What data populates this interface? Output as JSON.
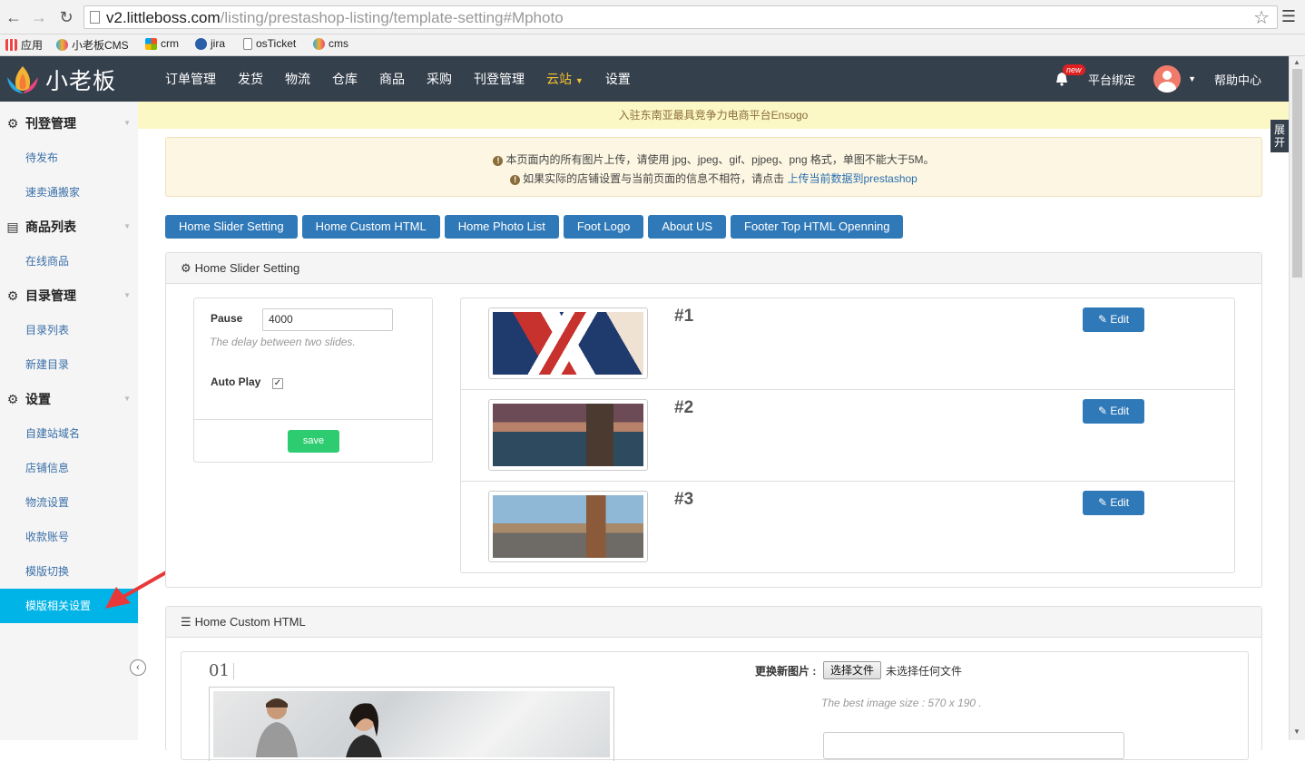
{
  "browser": {
    "url_host": "v2.littleboss.com",
    "url_path": "/listing/prestashop-listing/template-setting#Mphoto",
    "bookmarks": [
      "应用",
      "小老板CMS",
      "crm",
      "jira",
      "osTicket",
      "cms"
    ]
  },
  "topbar": {
    "logo_text": "小老板",
    "nav": [
      "订单管理",
      "发货",
      "物流",
      "仓库",
      "商品",
      "采购",
      "刊登管理",
      "云站",
      "设置"
    ],
    "active_nav": "云站",
    "new_badge": "new",
    "platform_bind": "平台绑定",
    "help_center": "帮助中心",
    "active_color": "#f5c230"
  },
  "sidebar": {
    "groups": [
      {
        "label": "刊登管理",
        "items": [
          "待发布",
          "速卖通搬家"
        ]
      },
      {
        "label": "商品列表",
        "items": [
          "在线商品"
        ]
      },
      {
        "label": "目录管理",
        "items": [
          "目录列表",
          "新建目录"
        ]
      },
      {
        "label": "设置",
        "items": [
          "自建站域名",
          "店铺信息",
          "物流设置",
          "收款账号",
          "模版切换",
          "模版相关设置"
        ]
      }
    ],
    "active_item": "模版相关设置",
    "active_color": "#00b4e8"
  },
  "expand_tab": "展开",
  "announcement": "入驻东南亚最具竞争力电商平台Ensogo",
  "notice": {
    "line1": "本页面内的所有图片上传，请使用 jpg、jpeg、gif、pjpeg、png 格式，单图不能大于5M。",
    "line2_prefix": "如果实际的店铺设置与当前页面的信息不相符，请点击",
    "line2_link": "上传当前数据到prestashop"
  },
  "tabs": [
    "Home Slider Setting",
    "Home Custom HTML",
    "Home Photo List",
    "Foot Logo",
    "About US",
    "Footer Top HTML Openning"
  ],
  "slider_panel": {
    "title": "Home Slider Setting",
    "pause_label": "Pause",
    "pause_value": "4000",
    "pause_help": "The delay between two slides.",
    "autoplay_label": "Auto Play",
    "autoplay_checked": true,
    "save_label": "save",
    "slides": [
      {
        "num": "#1",
        "edit": "Edit"
      },
      {
        "num": "#2",
        "edit": "Edit"
      },
      {
        "num": "#3",
        "edit": "Edit"
      }
    ]
  },
  "custom_html_panel": {
    "title": "Home Custom HTML",
    "index": "01",
    "change_image_label": "更换新图片 :",
    "choose_file": "选择文件",
    "no_file": "未选择任何文件",
    "size_hint": "The best image size : 570 x 190 ."
  }
}
